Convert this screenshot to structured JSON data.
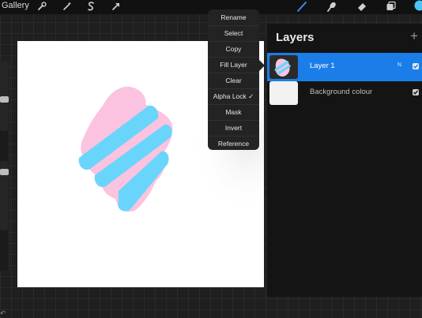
{
  "toolbar": {
    "gallery_label": "Gallery",
    "left_icons": [
      "wrench-icon",
      "magic-wand-icon",
      "selection-s-icon",
      "arrow-icon"
    ],
    "right_icons": [
      "brush-icon",
      "smudge-icon",
      "eraser-icon",
      "layers-icon",
      "color-swatch"
    ],
    "active_color": "#4cc3f5"
  },
  "layer_menu": {
    "items": [
      "Rename",
      "Select",
      "Copy",
      "Fill Layer",
      "Clear",
      "Alpha Lock ✓",
      "Mask",
      "Invert",
      "Reference"
    ]
  },
  "layers_panel": {
    "title": "Layers",
    "add_icon": "+",
    "layers": [
      {
        "name": "Layer 1",
        "mode": "N",
        "visible": true,
        "active": true
      },
      {
        "name": "Background colour",
        "visible": true,
        "active": false
      }
    ]
  },
  "colors": {
    "pink": "#fbc3df",
    "blue": "#6ad5fb",
    "accent": "#1b7ee8"
  }
}
